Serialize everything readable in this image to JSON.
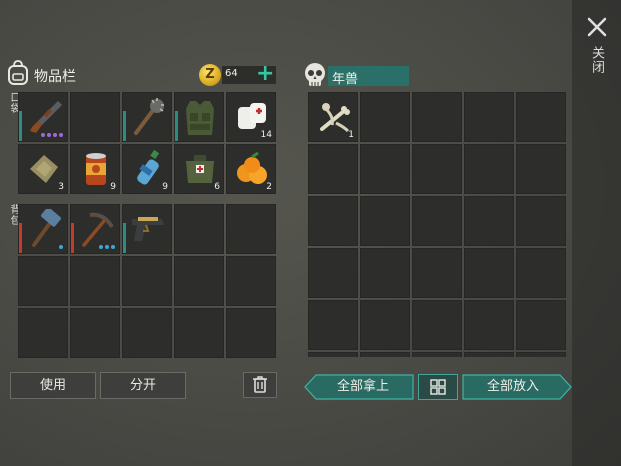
{
  "header": {
    "inventory_title": "物品栏",
    "coin_symbol": "Z",
    "coin_count": "64",
    "add_symbol": "+"
  },
  "sections": {
    "pocket_label": "口袋",
    "backpack_label": "背包"
  },
  "pocket": [
    {
      "icon": "shotgun-icon",
      "count": "",
      "bar": "#2a8f82",
      "dots": [
        "#9d6ad8",
        "#9d6ad8",
        "#9d6ad8",
        "#9d6ad8"
      ]
    },
    {
      "icon": "empty",
      "count": ""
    },
    {
      "icon": "spiked-club-icon",
      "count": "",
      "bar": "#2a8f82"
    },
    {
      "icon": "military-vest-icon",
      "count": "",
      "bar": "#2a8f82"
    },
    {
      "icon": "bandage-icon",
      "count": "14"
    },
    {
      "icon": "cloth-icon",
      "count": "3"
    },
    {
      "icon": "canned-food-icon",
      "count": "9"
    },
    {
      "icon": "water-bottle-icon",
      "count": "9"
    },
    {
      "icon": "first-aid-kit-icon",
      "count": "6"
    },
    {
      "icon": "kumquat-icon",
      "count": "2"
    }
  ],
  "backpack": [
    {
      "icon": "sledgehammer-icon",
      "count": "",
      "bar": "#c33a2e",
      "dots": [
        "#3aa6d8"
      ]
    },
    {
      "icon": "pickaxe-icon",
      "count": "",
      "bar": "#c33a2e",
      "dots": [
        "#3aa6d8",
        "#3aa6d8",
        "#3aa6d8"
      ]
    },
    {
      "icon": "pistol-icon",
      "count": "",
      "bar": "#2a8f82"
    },
    {
      "icon": "empty",
      "count": ""
    },
    {
      "icon": "empty",
      "count": ""
    },
    {
      "icon": "empty",
      "count": ""
    },
    {
      "icon": "empty",
      "count": ""
    },
    {
      "icon": "empty",
      "count": ""
    },
    {
      "icon": "empty",
      "count": ""
    },
    {
      "icon": "empty",
      "count": ""
    },
    {
      "icon": "empty",
      "count": ""
    },
    {
      "icon": "empty",
      "count": ""
    },
    {
      "icon": "empty",
      "count": ""
    },
    {
      "icon": "empty",
      "count": ""
    },
    {
      "icon": "empty",
      "count": ""
    }
  ],
  "container": {
    "title": "年兽",
    "items": [
      {
        "icon": "bones-icon",
        "count": "1"
      }
    ]
  },
  "buttons": {
    "use": "使用",
    "split": "分开",
    "take_all": "全部拿上",
    "put_all": "全部放入",
    "close_label": "关闭"
  }
}
